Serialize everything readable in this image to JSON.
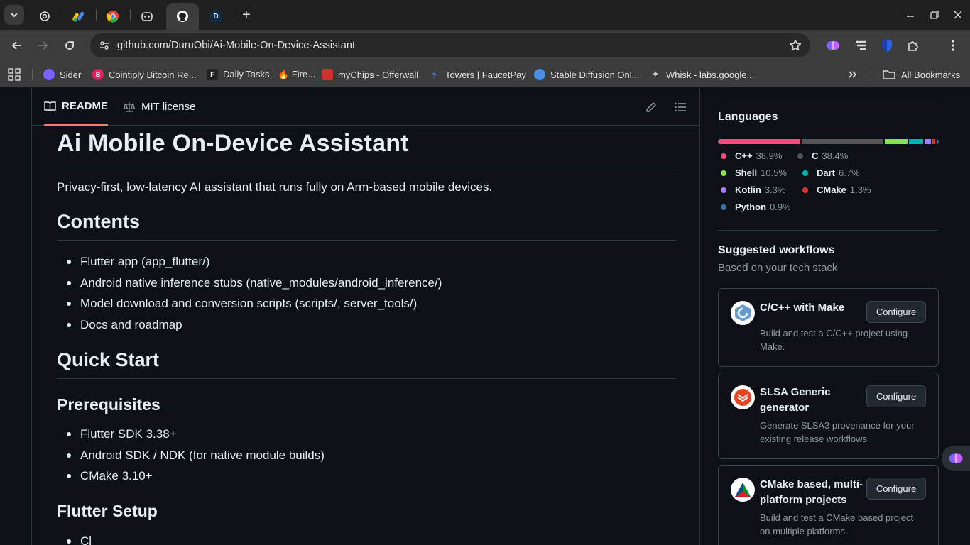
{
  "browser": {
    "url": "github.com/DuruObi/Ai-Mobile-On-Device-Assistant",
    "active_tab_letter": "D",
    "new_tab_label": "+",
    "bookmarks": [
      {
        "label": "Sider",
        "icon": "sider-icon",
        "color": "#7b61ff"
      },
      {
        "label": "Cointiply Bitcoin Re...",
        "icon": "cointiply-icon",
        "color": "#e0245e"
      },
      {
        "label": "Daily Tasks - 🔥 Fire...",
        "icon": "fire-f-icon",
        "color": "#222222"
      },
      {
        "label": "myChips - Offerwall",
        "icon": "mychips-icon",
        "color": "#d32f2f"
      },
      {
        "label": "Towers | FaucetPay",
        "icon": "faucetpay-icon",
        "color": "#3b82f6"
      },
      {
        "label": "Stable Diffusion Onl...",
        "icon": "stable-diffusion-icon",
        "color": "#4a90e2"
      },
      {
        "label": "Whisk - labs.google...",
        "icon": "whisk-icon",
        "color": "#cccccc"
      }
    ],
    "all_bookmarks": "All Bookmarks"
  },
  "readme": {
    "tabs": [
      {
        "label": "README",
        "icon": "book-icon"
      },
      {
        "label": "MIT license",
        "icon": "law-icon"
      }
    ],
    "title": "Ai Mobile On-Device Assistant",
    "lead": "Privacy-first, low-latency AI assistant that runs fully on Arm-based mobile devices.",
    "contents_heading": "Contents",
    "contents": [
      "Flutter app (app_flutter/)",
      "Android native inference stubs (native_modules/android_inference/)",
      "Model download and conversion scripts (scripts/, server_tools/)",
      "Docs and roadmap"
    ],
    "quickstart_heading": "Quick Start",
    "prereq_heading": "Prerequisites",
    "prereqs": [
      "Flutter SDK 3.38+",
      "Android SDK / NDK (for native module builds)",
      "CMake 3.10+"
    ],
    "flutter_setup_heading": "Flutter Setup",
    "flutter_setup_first": "Cl"
  },
  "sidebar": {
    "languages_heading": "Languages",
    "languages": [
      {
        "name": "C++",
        "pct": "38.9%",
        "value": 38.9,
        "color": "#f34b7d"
      },
      {
        "name": "C",
        "pct": "38.4%",
        "value": 38.4,
        "color": "#555555"
      },
      {
        "name": "Shell",
        "pct": "10.5%",
        "value": 10.5,
        "color": "#89e051"
      },
      {
        "name": "Dart",
        "pct": "6.7%",
        "value": 6.7,
        "color": "#00b4ab"
      },
      {
        "name": "Kotlin",
        "pct": "3.3%",
        "value": 3.3,
        "color": "#a97bff"
      },
      {
        "name": "CMake",
        "pct": "1.3%",
        "value": 1.3,
        "color": "#da3434"
      },
      {
        "name": "Python",
        "pct": "0.9%",
        "value": 0.9,
        "color": "#3572a5"
      }
    ],
    "workflows_heading": "Suggested workflows",
    "workflows_sub": "Based on your tech stack",
    "workflows": [
      {
        "title": "C/C++ with Make",
        "desc": "Build and test a C/C++ project using Make.",
        "button": "Configure",
        "icon": "cpp-icon"
      },
      {
        "title": "SLSA Generic generator",
        "desc": "Generate SLSA3 provenance for your existing release workflows",
        "button": "Configure",
        "icon": "slsa-icon"
      },
      {
        "title": "CMake based, multi-platform projects",
        "desc": "Build and test a CMake based project on multiple platforms.",
        "button": "Configure",
        "icon": "cmake-icon"
      }
    ]
  }
}
